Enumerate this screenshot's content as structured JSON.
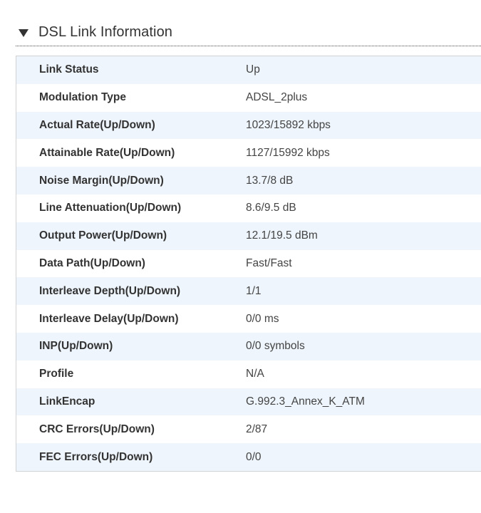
{
  "section": {
    "title": "DSL Link Information"
  },
  "rows": [
    {
      "label": "Link Status",
      "value": "Up"
    },
    {
      "label": "Modulation Type",
      "value": "ADSL_2plus"
    },
    {
      "label": "Actual Rate(Up/Down)",
      "value": "1023/15892 kbps"
    },
    {
      "label": "Attainable Rate(Up/Down)",
      "value": "1127/15992 kbps"
    },
    {
      "label": "Noise Margin(Up/Down)",
      "value": "13.7/8 dB"
    },
    {
      "label": "Line Attenuation(Up/Down)",
      "value": "8.6/9.5 dB"
    },
    {
      "label": "Output Power(Up/Down)",
      "value": "12.1/19.5 dBm"
    },
    {
      "label": "Data Path(Up/Down)",
      "value": "Fast/Fast"
    },
    {
      "label": "Interleave Depth(Up/Down)",
      "value": "1/1"
    },
    {
      "label": "Interleave Delay(Up/Down)",
      "value": "0/0 ms"
    },
    {
      "label": "INP(Up/Down)",
      "value": "0/0 symbols"
    },
    {
      "label": "Profile",
      "value": "N/A"
    },
    {
      "label": "LinkEncap",
      "value": "G.992.3_Annex_K_ATM"
    },
    {
      "label": "CRC Errors(Up/Down)",
      "value": "2/87"
    },
    {
      "label": "FEC Errors(Up/Down)",
      "value": "0/0"
    }
  ],
  "colors": {
    "alt_row": "#eef5fc",
    "text": "#333333"
  },
  "icons": {
    "collapse": "triangle-down-icon"
  }
}
